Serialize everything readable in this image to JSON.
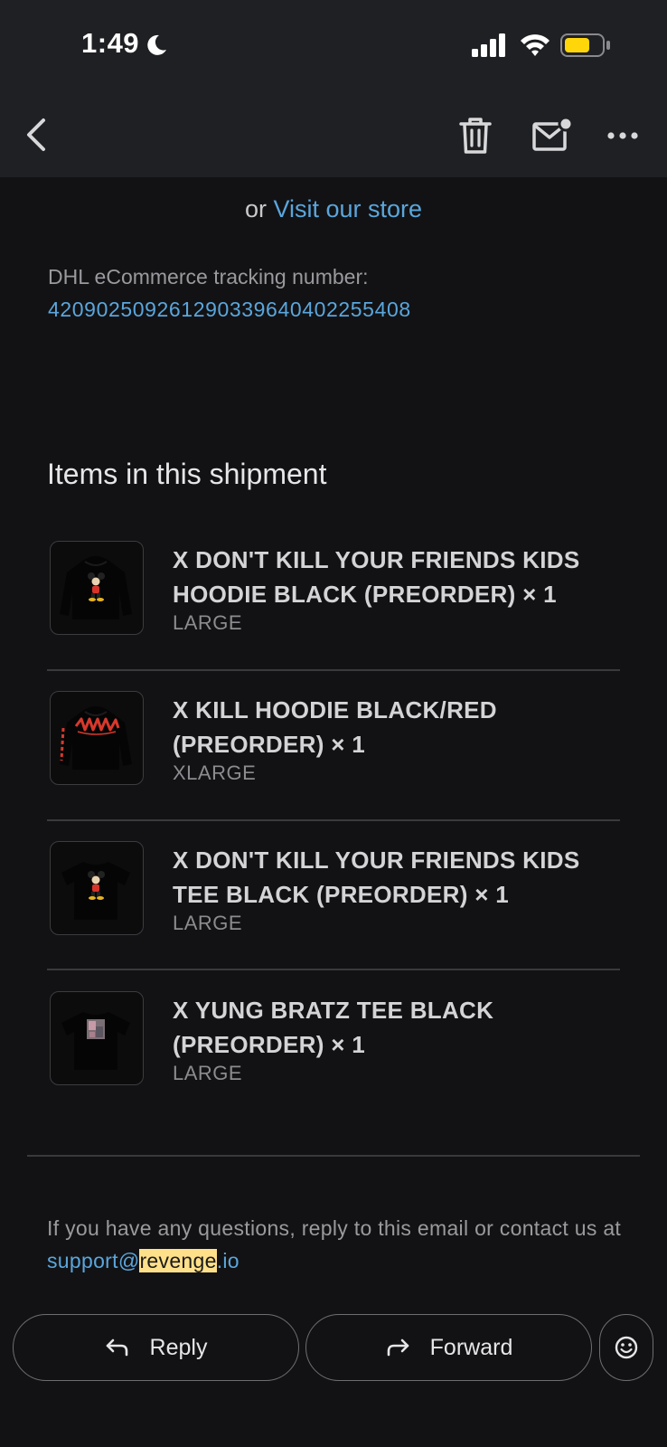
{
  "status_bar": {
    "time": "1:49"
  },
  "toolbar": {
    "back_icon": "chevron-left-icon",
    "delete_icon": "trash-icon",
    "mark_unread_icon": "mail-unread-icon",
    "more_icon": "more-horizontal-icon"
  },
  "email": {
    "or_text": "or ",
    "visit_store_link": "Visit our store",
    "tracking_label": "DHL eCommerce tracking number:",
    "tracking_number": "420902509261290339640402255408",
    "items_heading": "Items in this shipment",
    "items": [
      {
        "title": "X DON'T KILL YOUR FRIENDS KIDS HOODIE BLACK (PREORDER) × 1",
        "variant": "LARGE",
        "thumb": "hoodie-mickey"
      },
      {
        "title": "X KILL HOODIE BLACK/RED (PREORDER) × 1",
        "variant": "XLARGE",
        "thumb": "hoodie-revenge"
      },
      {
        "title": "X DON'T KILL YOUR FRIENDS KIDS TEE BLACK (PREORDER) × 1",
        "variant": "LARGE",
        "thumb": "tee-mickey"
      },
      {
        "title": "X YUNG BRATZ TEE BLACK (PREORDER) × 1",
        "variant": "LARGE",
        "thumb": "tee-photo"
      }
    ],
    "footer_text": "If you have any questions, reply to this email or contact us at ",
    "support_email_prefix": "support@",
    "support_email_highlight": "revenge",
    "support_email_suffix": ".io"
  },
  "actions": {
    "reply_label": "Reply",
    "forward_label": "Forward",
    "reply_icon": "reply-arrow-icon",
    "forward_icon": "forward-arrow-icon",
    "emoji_icon": "smiley-icon"
  },
  "colors": {
    "background": "#121214",
    "topbar": "#1f2023",
    "link": "#5aa6dc",
    "battery": "#ffd60a",
    "highlight": "#ffe08a",
    "revenge_red": "#d8392b"
  }
}
